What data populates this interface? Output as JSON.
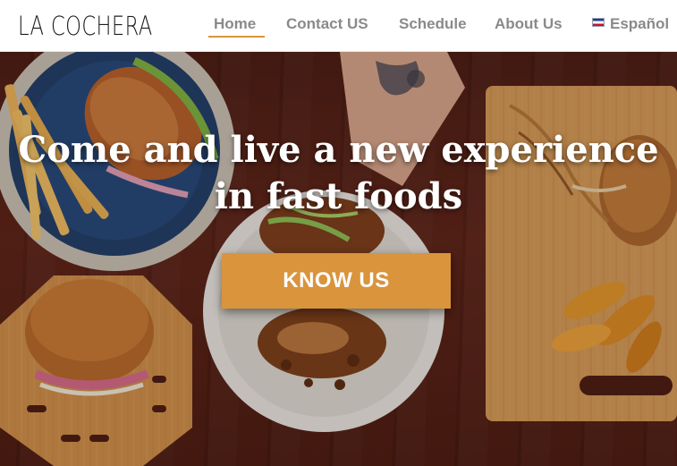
{
  "brand": {
    "logo_text": "LA COCHERA"
  },
  "nav": {
    "items": [
      {
        "label": "Home",
        "active": true
      },
      {
        "label": "Contact US",
        "active": false
      },
      {
        "label": "Schedule",
        "active": false
      },
      {
        "label": "About Us",
        "active": false
      },
      {
        "label": "Español",
        "active": false,
        "icon": "costa-rica-flag-icon"
      }
    ]
  },
  "hero": {
    "headline_line1": "Come and live a new experience",
    "headline_line2": "in fast foods",
    "cta_label": "KNOW US"
  },
  "colors": {
    "accent": "#d9943c",
    "nav_text": "#8a8a8a",
    "logo_text": "#1d1d1d",
    "hero_text": "#ffffff",
    "table_wood": "#4e1f15"
  }
}
